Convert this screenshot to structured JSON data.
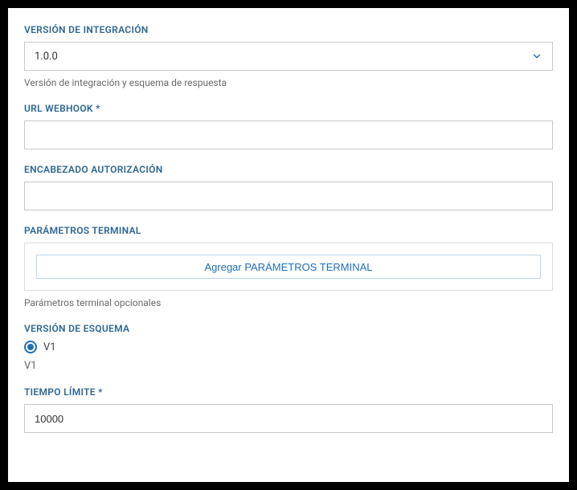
{
  "integration_version": {
    "label": "VERSIÓN DE INTEGRACIÓN",
    "value": "1.0.0",
    "help": "Versión de integración y esquema de respuesta"
  },
  "webhook_url": {
    "label": "URL WEBHOOK *",
    "value": ""
  },
  "auth_header": {
    "label": "ENCABEZADO AUTORIZACIÓN",
    "value": ""
  },
  "terminal_params": {
    "label": "PARÁMETROS TERMINAL",
    "add_button": "Agregar PARÁMETROS TERMINAL",
    "help": "Parámetros terminal opcionales"
  },
  "schema_version": {
    "label": "VERSIÓN DE ESQUEMA",
    "option": "V1",
    "help": "V1"
  },
  "timeout": {
    "label": "TIEMPO LÍMITE *",
    "value": "10000"
  }
}
